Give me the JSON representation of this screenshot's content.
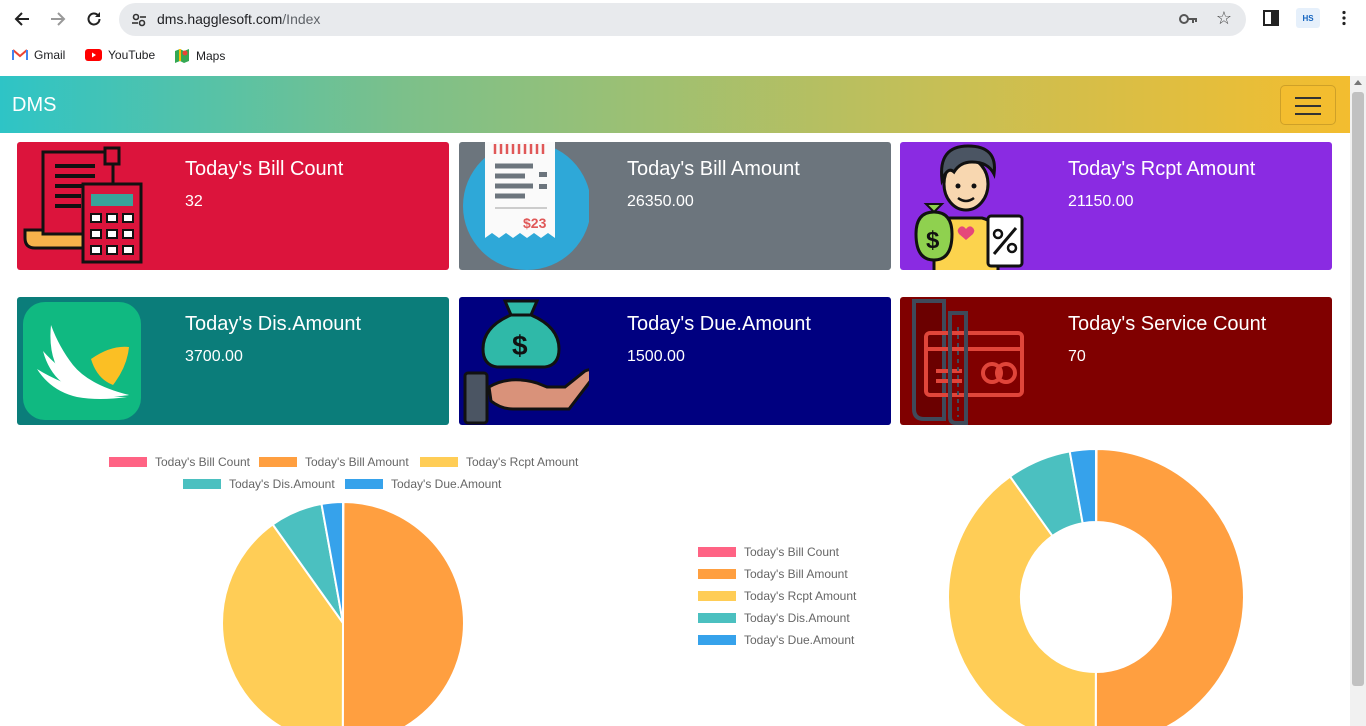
{
  "browser": {
    "url_host": "dms.hagglesoft.com",
    "url_path": "/Index",
    "bookmarks": [
      {
        "label": "Gmail",
        "icon": "gmail-icon"
      },
      {
        "label": "YouTube",
        "icon": "youtube-icon"
      },
      {
        "label": "Maps",
        "icon": "maps-icon"
      }
    ]
  },
  "app": {
    "brand": "DMS"
  },
  "cards": [
    {
      "title": "Today's Bill Count",
      "value": "32",
      "color": "#dc143c",
      "icon": "calculator-receipt-icon"
    },
    {
      "title": "Today's Bill Amount",
      "value": "26350.00",
      "color": "#6c757d",
      "icon": "receipt-icon"
    },
    {
      "title": "Today's Rcpt Amount",
      "value": "21150.00",
      "color": "#8a2be2",
      "icon": "person-money-icon"
    },
    {
      "title": "Today's Dis.Amount",
      "value": "3700.00",
      "color": "#0b7d7a",
      "icon": "leaf-app-icon"
    },
    {
      "title": "Today's Due.Amount",
      "value": "1500.00",
      "color": "#000080",
      "icon": "hand-money-bag-icon"
    },
    {
      "title": "Today's Service Count",
      "value": "70",
      "color": "#800000",
      "icon": "credit-card-receipt-icon"
    }
  ],
  "chart_data": [
    {
      "type": "pie",
      "categories": [
        "Today's Bill Count",
        "Today's Bill Amount",
        "Today's Rcpt Amount",
        "Today's Dis.Amount",
        "Today's Due.Amount"
      ],
      "values": [
        32,
        26350,
        21150,
        3700,
        1500
      ],
      "colors": [
        "#ff6384",
        "#ff9f40",
        "#ffcd56",
        "#4bc0c0",
        "#36a2eb"
      ],
      "legend_position": "top"
    },
    {
      "type": "doughnut",
      "categories": [
        "Today's Bill Count",
        "Today's Bill Amount",
        "Today's Rcpt Amount",
        "Today's Dis.Amount",
        "Today's Due.Amount"
      ],
      "values": [
        32,
        26350,
        21150,
        3700,
        1500
      ],
      "colors": [
        "#ff6384",
        "#ff9f40",
        "#ffcd56",
        "#4bc0c0",
        "#36a2eb"
      ],
      "legend_position": "left"
    }
  ]
}
